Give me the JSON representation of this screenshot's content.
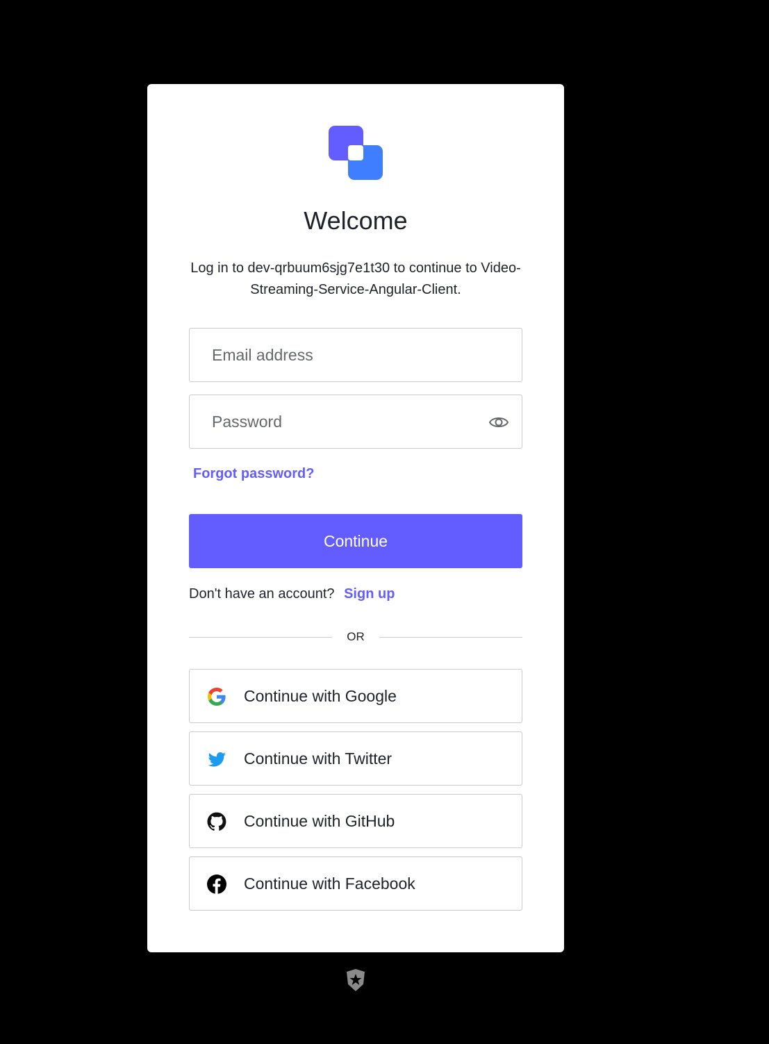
{
  "brand": {
    "primary_color": "#635dff",
    "logo_colors": [
      "#635dff",
      "#3f7fff"
    ],
    "logo_icon": "overlapping-squares-logo"
  },
  "header": {
    "title": "Welcome",
    "subtitle": "Log in to dev-qrbuum6sjg7e1t30 to continue to Video-Streaming-Service-Angular-Client."
  },
  "form": {
    "email": {
      "placeholder": "Email address",
      "value": ""
    },
    "password": {
      "placeholder": "Password",
      "value": "",
      "toggle_icon": "eye-icon"
    },
    "forgot_label": "Forgot password?",
    "continue_label": "Continue"
  },
  "signup": {
    "prompt": "Don't have an account?",
    "link_label": "Sign up"
  },
  "divider": {
    "label": "OR"
  },
  "social": [
    {
      "label": "Continue with Google",
      "icon": "google-icon"
    },
    {
      "label": "Continue with Twitter",
      "icon": "twitter-icon"
    },
    {
      "label": "Continue with GitHub",
      "icon": "github-icon"
    },
    {
      "label": "Continue with Facebook",
      "icon": "facebook-icon"
    }
  ],
  "footer": {
    "badge_icon": "auth0-shield-icon"
  }
}
